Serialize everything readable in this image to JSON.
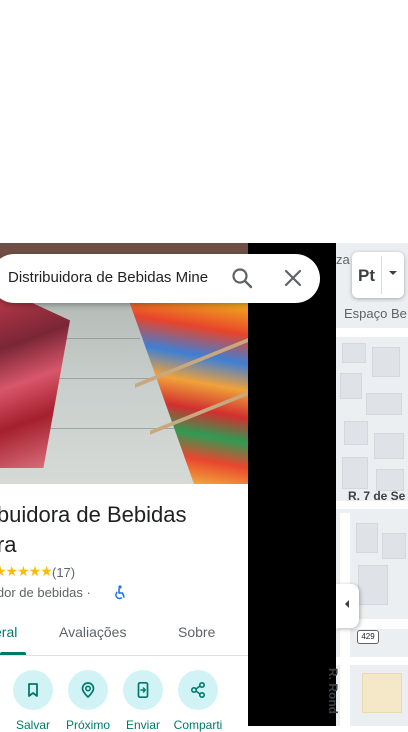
{
  "search": {
    "query": "Distribuidora de Bebidas Mine"
  },
  "map": {
    "type_button_label": "Pt",
    "label_top_left": "za",
    "label_espaco": "Espaço Be",
    "label_street": "R. 7 de Se",
    "label_rondon": "R. Rond",
    "route_number": "429"
  },
  "place": {
    "title": "ibuidora de Bebidas ira",
    "title_line1": "ibuidora de Bebidas",
    "title_line2": "ira",
    "stars": "★★★★★",
    "rating_count": "(17)",
    "category": "idor de bebidas ·"
  },
  "tabs": {
    "overview": "eral",
    "reviews": "Avaliações",
    "about": "Sobre"
  },
  "actions": {
    "save": "Salvar",
    "nearby": "Próximo",
    "send": "Enviar",
    "share": "Comparti"
  },
  "colors": {
    "accent": "#00796b",
    "action_bg": "#d2f3f6",
    "star": "#fbbc04"
  }
}
